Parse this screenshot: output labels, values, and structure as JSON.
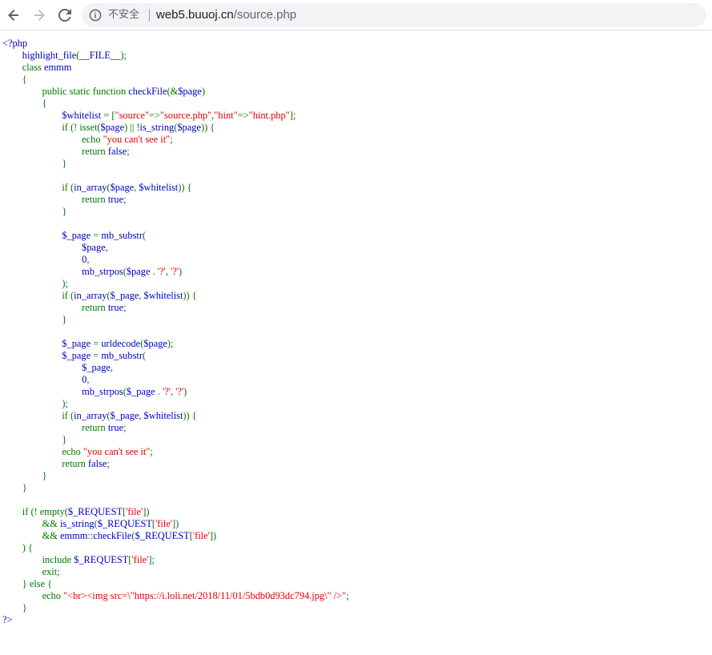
{
  "browser": {
    "security_label": "不安全",
    "url_host": "web5.buuoj.cn",
    "url_path": "/source.php",
    "icons": {
      "back": "arrow-left-icon",
      "forward": "arrow-right-icon",
      "reload": "reload-icon",
      "info": "info-circle-icon"
    }
  },
  "colors": {
    "php_default": "#0000bb",
    "php_keyword": "#007700",
    "php_string": "#dd0000"
  },
  "source_lines": [
    [
      [
        "default",
        "<?php"
      ]
    ],
    [
      [
        "default",
        "        highlight_file"
      ],
      [
        "keyword",
        "("
      ],
      [
        "default",
        "__FILE__"
      ],
      [
        "keyword",
        ");"
      ]
    ],
    [
      [
        "keyword",
        "        class "
      ],
      [
        "default",
        "emmm"
      ]
    ],
    [
      [
        "keyword",
        "        {"
      ]
    ],
    [
      [
        "keyword",
        "                public static function "
      ],
      [
        "default",
        "checkFile"
      ],
      [
        "keyword",
        "(&"
      ],
      [
        "default",
        "$page"
      ],
      [
        "keyword",
        ")"
      ]
    ],
    [
      [
        "keyword",
        "                {"
      ]
    ],
    [
      [
        "default",
        "                        $whitelist "
      ],
      [
        "keyword",
        "= ["
      ],
      [
        "string",
        "\"source\""
      ],
      [
        "keyword",
        "=>"
      ],
      [
        "string",
        "\"source.php\""
      ],
      [
        "keyword",
        ","
      ],
      [
        "string",
        "\"hint\""
      ],
      [
        "keyword",
        "=>"
      ],
      [
        "string",
        "\"hint.php\""
      ],
      [
        "keyword",
        "];"
      ]
    ],
    [
      [
        "keyword",
        "                        if (! isset("
      ],
      [
        "default",
        "$page"
      ],
      [
        "keyword",
        ") || !"
      ],
      [
        "default",
        "is_string"
      ],
      [
        "keyword",
        "("
      ],
      [
        "default",
        "$page"
      ],
      [
        "keyword",
        ")) {"
      ]
    ],
    [
      [
        "keyword",
        "                                echo "
      ],
      [
        "string",
        "\"you can't see it\""
      ],
      [
        "keyword",
        ";"
      ]
    ],
    [
      [
        "keyword",
        "                                return "
      ],
      [
        "default",
        "false"
      ],
      [
        "keyword",
        ";"
      ]
    ],
    [
      [
        "keyword",
        "                        }"
      ]
    ],
    [
      [
        "keyword",
        ""
      ]
    ],
    [
      [
        "keyword",
        "                        if ("
      ],
      [
        "default",
        "in_array"
      ],
      [
        "keyword",
        "("
      ],
      [
        "default",
        "$page"
      ],
      [
        "keyword",
        ", "
      ],
      [
        "default",
        "$whitelist"
      ],
      [
        "keyword",
        ")) {"
      ]
    ],
    [
      [
        "keyword",
        "                                return "
      ],
      [
        "default",
        "true"
      ],
      [
        "keyword",
        ";"
      ]
    ],
    [
      [
        "keyword",
        "                        }"
      ]
    ],
    [
      [
        "keyword",
        ""
      ]
    ],
    [
      [
        "default",
        "                        $_page "
      ],
      [
        "keyword",
        "= "
      ],
      [
        "default",
        "mb_substr"
      ],
      [
        "keyword",
        "("
      ]
    ],
    [
      [
        "default",
        "                                $page"
      ],
      [
        "keyword",
        ","
      ]
    ],
    [
      [
        "default",
        "                                0"
      ],
      [
        "keyword",
        ","
      ]
    ],
    [
      [
        "default",
        "                                mb_strpos"
      ],
      [
        "keyword",
        "("
      ],
      [
        "default",
        "$page "
      ],
      [
        "keyword",
        ". "
      ],
      [
        "string",
        "'?'"
      ],
      [
        "keyword",
        ", "
      ],
      [
        "string",
        "'?'"
      ],
      [
        "keyword",
        ")"
      ]
    ],
    [
      [
        "keyword",
        "                        );"
      ]
    ],
    [
      [
        "keyword",
        "                        if ("
      ],
      [
        "default",
        "in_array"
      ],
      [
        "keyword",
        "("
      ],
      [
        "default",
        "$_page"
      ],
      [
        "keyword",
        ", "
      ],
      [
        "default",
        "$whitelist"
      ],
      [
        "keyword",
        ")) {"
      ]
    ],
    [
      [
        "keyword",
        "                                return "
      ],
      [
        "default",
        "true"
      ],
      [
        "keyword",
        ";"
      ]
    ],
    [
      [
        "keyword",
        "                        }"
      ]
    ],
    [
      [
        "keyword",
        ""
      ]
    ],
    [
      [
        "default",
        "                        $_page "
      ],
      [
        "keyword",
        "= "
      ],
      [
        "default",
        "urldecode"
      ],
      [
        "keyword",
        "("
      ],
      [
        "default",
        "$page"
      ],
      [
        "keyword",
        ");"
      ]
    ],
    [
      [
        "default",
        "                        $_page "
      ],
      [
        "keyword",
        "= "
      ],
      [
        "default",
        "mb_substr"
      ],
      [
        "keyword",
        "("
      ]
    ],
    [
      [
        "default",
        "                                $_page"
      ],
      [
        "keyword",
        ","
      ]
    ],
    [
      [
        "default",
        "                                0"
      ],
      [
        "keyword",
        ","
      ]
    ],
    [
      [
        "default",
        "                                mb_strpos"
      ],
      [
        "keyword",
        "("
      ],
      [
        "default",
        "$_page "
      ],
      [
        "keyword",
        ". "
      ],
      [
        "string",
        "'?'"
      ],
      [
        "keyword",
        ", "
      ],
      [
        "string",
        "'?'"
      ],
      [
        "keyword",
        ")"
      ]
    ],
    [
      [
        "keyword",
        "                        );"
      ]
    ],
    [
      [
        "keyword",
        "                        if ("
      ],
      [
        "default",
        "in_array"
      ],
      [
        "keyword",
        "("
      ],
      [
        "default",
        "$_page"
      ],
      [
        "keyword",
        ", "
      ],
      [
        "default",
        "$whitelist"
      ],
      [
        "keyword",
        ")) {"
      ]
    ],
    [
      [
        "keyword",
        "                                return "
      ],
      [
        "default",
        "true"
      ],
      [
        "keyword",
        ";"
      ]
    ],
    [
      [
        "keyword",
        "                        }"
      ]
    ],
    [
      [
        "keyword",
        "                        echo "
      ],
      [
        "string",
        "\"you can't see it\""
      ],
      [
        "keyword",
        ";"
      ]
    ],
    [
      [
        "keyword",
        "                        return "
      ],
      [
        "default",
        "false"
      ],
      [
        "keyword",
        ";"
      ]
    ],
    [
      [
        "keyword",
        "                }"
      ]
    ],
    [
      [
        "keyword",
        "        }"
      ]
    ],
    [
      [
        "keyword",
        ""
      ]
    ],
    [
      [
        "keyword",
        "        if (! empty("
      ],
      [
        "default",
        "$_REQUEST"
      ],
      [
        "keyword",
        "["
      ],
      [
        "string",
        "'file'"
      ],
      [
        "keyword",
        "])"
      ]
    ],
    [
      [
        "keyword",
        "                && "
      ],
      [
        "default",
        "is_string"
      ],
      [
        "keyword",
        "("
      ],
      [
        "default",
        "$_REQUEST"
      ],
      [
        "keyword",
        "["
      ],
      [
        "string",
        "'file'"
      ],
      [
        "keyword",
        "])"
      ]
    ],
    [
      [
        "keyword",
        "                && "
      ],
      [
        "default",
        "emmm"
      ],
      [
        "keyword",
        "::"
      ],
      [
        "default",
        "checkFile"
      ],
      [
        "keyword",
        "("
      ],
      [
        "default",
        "$_REQUEST"
      ],
      [
        "keyword",
        "["
      ],
      [
        "string",
        "'file'"
      ],
      [
        "keyword",
        "])"
      ]
    ],
    [
      [
        "keyword",
        "        ) {"
      ]
    ],
    [
      [
        "keyword",
        "                include "
      ],
      [
        "default",
        "$_REQUEST"
      ],
      [
        "keyword",
        "["
      ],
      [
        "string",
        "'file'"
      ],
      [
        "keyword",
        "];"
      ]
    ],
    [
      [
        "keyword",
        "                exit;"
      ]
    ],
    [
      [
        "keyword",
        "        } else {"
      ]
    ],
    [
      [
        "keyword",
        "                echo "
      ],
      [
        "string",
        "\"<br><img src=\\\"https://i.loli.net/2018/11/01/5bdb0d93dc794.jpg\\\" />\""
      ],
      [
        "keyword",
        ";"
      ]
    ],
    [
      [
        "keyword",
        "        }"
      ]
    ],
    [
      [
        "default",
        "?>"
      ]
    ]
  ]
}
